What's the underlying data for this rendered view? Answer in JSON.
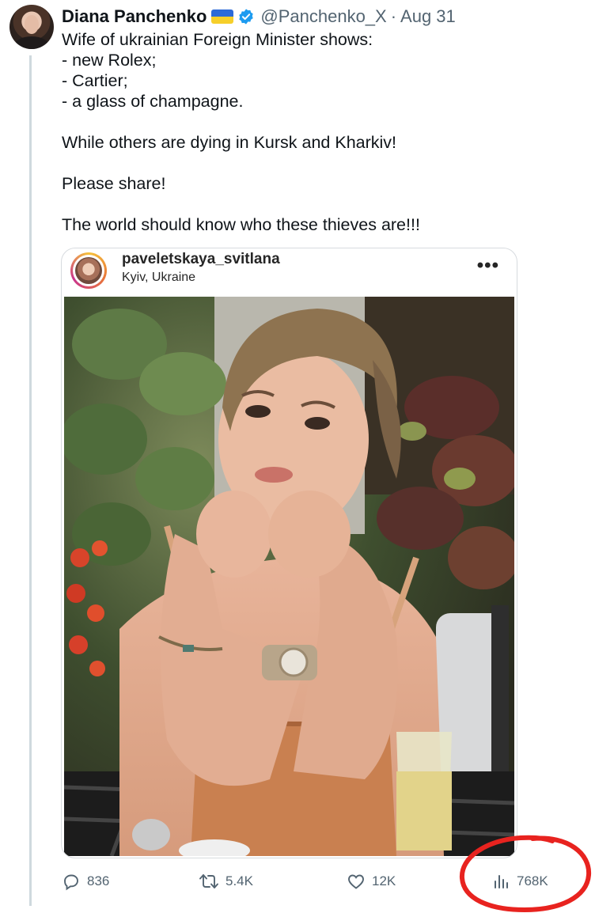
{
  "tweet": {
    "author_name": "Diana Panchenko",
    "handle": "@Panchenko_X",
    "separator": "·",
    "date": "Aug 31",
    "text_lines": [
      "Wife of ukrainian Foreign Minister shows:",
      "- new Rolex;",
      "- Cartier;",
      "- a glass of champagne.",
      "",
      "While others are dying in Kursk and Kharkiv!",
      "",
      "Please share!",
      "",
      "The world should know who these thieves are!!!"
    ]
  },
  "embed": {
    "username": "paveletskaya_svitlana",
    "location": "Kyiv, Ukraine",
    "more_label": "•••"
  },
  "metrics": {
    "replies": "836",
    "reposts": "5.4K",
    "likes": "12K",
    "views": "768K"
  },
  "colors": {
    "text": "#0f1419",
    "muted": "#536471",
    "verified": "#1d9bf0",
    "highlight": "#e8231f",
    "flag_blue": "#2b6ad8",
    "flag_yellow": "#f6cf2a"
  },
  "icons": [
    "reply-icon",
    "repost-icon",
    "like-icon",
    "views-icon",
    "verified-icon",
    "more-icon"
  ]
}
